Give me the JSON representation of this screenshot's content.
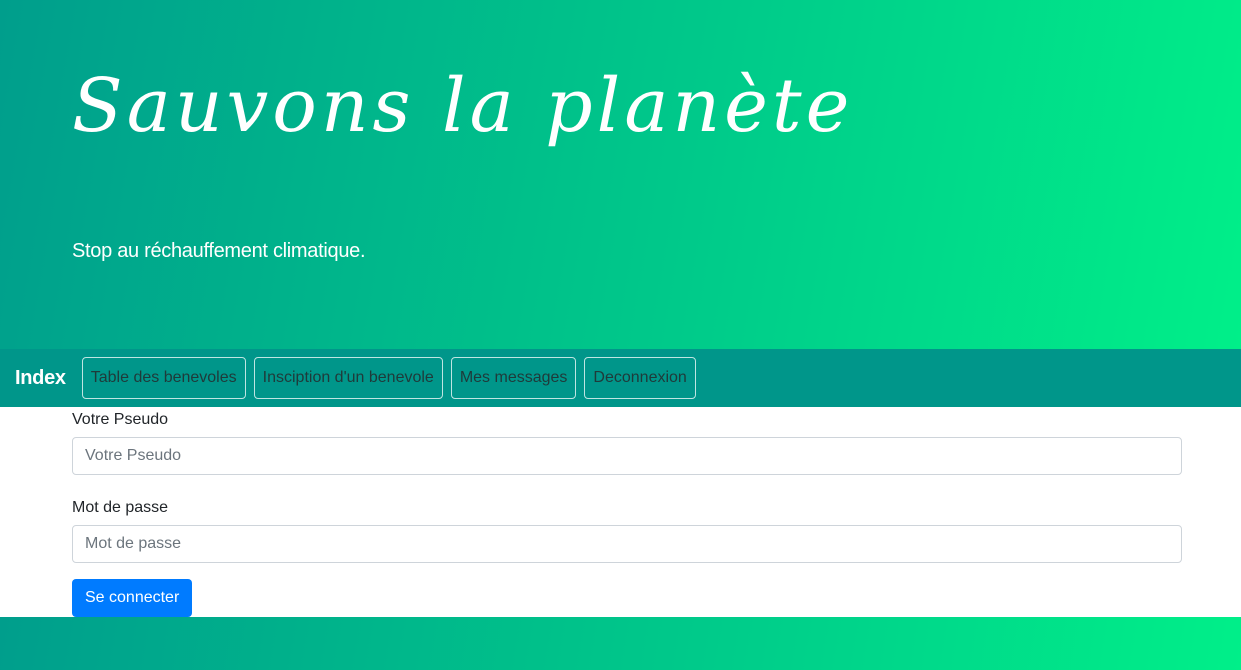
{
  "hero": {
    "title": "Sauvons la planète",
    "subtitle": "Stop au réchauffement climatique."
  },
  "navbar": {
    "brand": "Index",
    "items": [
      {
        "label": "Table des benevoles"
      },
      {
        "label": "Insciption d'un benevole"
      },
      {
        "label": "Mes messages"
      },
      {
        "label": "Deconnexion"
      }
    ]
  },
  "form": {
    "pseudo_label": "Votre Pseudo",
    "pseudo_placeholder": "Votre Pseudo",
    "pseudo_value": "",
    "password_label": "Mot de passe",
    "password_placeholder": "Mot de passe",
    "password_value": "",
    "submit_label": "Se connecter"
  },
  "colors": {
    "gradient_start": "#009e8c",
    "gradient_end": "#00ef89",
    "navbar": "#00968a",
    "primary_button": "#007bff"
  }
}
